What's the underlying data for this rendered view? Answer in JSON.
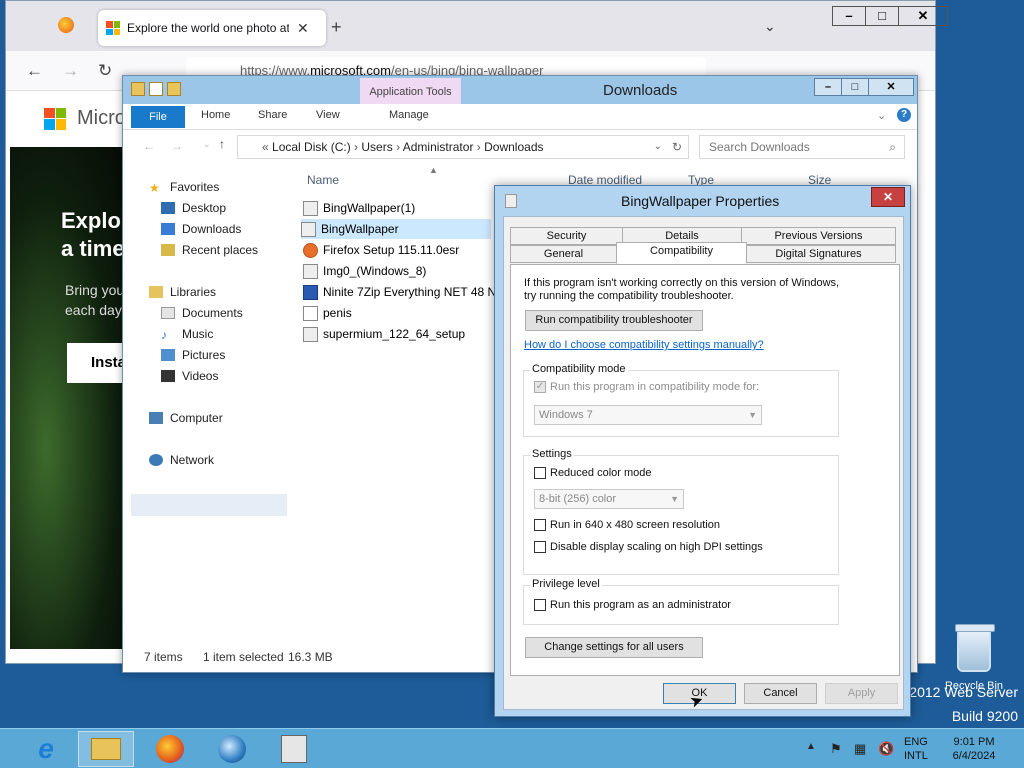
{
  "browser": {
    "tab_title": "Explore the world one photo at",
    "new_tab": "+",
    "list_tabs": "⌄",
    "url_prefix": "https://www.",
    "url_host": "microsoft.com",
    "url_path": "/en-us/bing/bing-wallpaper",
    "page": {
      "brand": "Micro",
      "hero_title_1": "Explo",
      "hero_title_2": "a time",
      "hero_sub_1": "Bring you",
      "hero_sub_2": "each day",
      "install_btn": "Insta"
    }
  },
  "explorer": {
    "title": "Downloads",
    "app_tools": "Application Tools",
    "ribbon": {
      "file": "File",
      "home": "Home",
      "share": "Share",
      "view": "View",
      "manage": "Manage"
    },
    "address": {
      "root": "Local Disk (C:)",
      "p1": "Users",
      "p2": "Administrator",
      "p3": "Downloads"
    },
    "search_placeholder": "Search Downloads",
    "nav": {
      "favorites": "Favorites",
      "desktop": "Desktop",
      "downloads": "Downloads",
      "recent": "Recent places",
      "libraries": "Libraries",
      "documents": "Documents",
      "music": "Music",
      "pictures": "Pictures",
      "videos": "Videos",
      "computer": "Computer",
      "network": "Network"
    },
    "columns": {
      "name": "Name",
      "modified": "Date modified",
      "type": "Type",
      "size": "Size"
    },
    "files": [
      "BingWallpaper(1)",
      "BingWallpaper",
      "Firefox Setup 115.11.0esr",
      "Img0_(Windows_8)",
      "Ninite 7Zip Everything NET 48 N",
      "penis",
      "supermium_122_64_setup"
    ],
    "status": {
      "count": "7 items",
      "selected": "1 item selected",
      "size": "16.3 MB"
    }
  },
  "props": {
    "title": "BingWallpaper Properties",
    "tabs": {
      "security": "Security",
      "details": "Details",
      "previous": "Previous Versions",
      "general": "General",
      "compat": "Compatibility",
      "signatures": "Digital Signatures"
    },
    "intro_1": "If this program isn't working correctly on this version of Windows,",
    "intro_2": "try running the compatibility troubleshooter.",
    "run_troubleshooter": "Run compatibility troubleshooter",
    "manual_link": "How do I choose compatibility settings manually?",
    "compat_mode": {
      "label": "Compatibility mode",
      "checkbox": "Run this program in compatibility mode for:",
      "checked": true,
      "os": "Windows 7"
    },
    "settings": {
      "label": "Settings",
      "reduced_color": "Reduced color mode",
      "color_value": "8-bit (256) color",
      "res_640": "Run in 640 x 480 screen resolution",
      "dpi": "Disable display scaling on high DPI settings"
    },
    "privilege": {
      "label": "Privilege level",
      "admin": "Run this program as an administrator"
    },
    "change_all": "Change settings for all users",
    "ok": "OK",
    "cancel": "Cancel",
    "apply": "Apply"
  },
  "desktop": {
    "recycle_bin": "Recycle Bin",
    "watermark_1": "2012 Web Server",
    "watermark_2": "Build 9200"
  },
  "taskbar": {
    "lang_1": "ENG",
    "lang_2": "INTL",
    "time": "9:01 PM",
    "date": "6/4/2024"
  }
}
